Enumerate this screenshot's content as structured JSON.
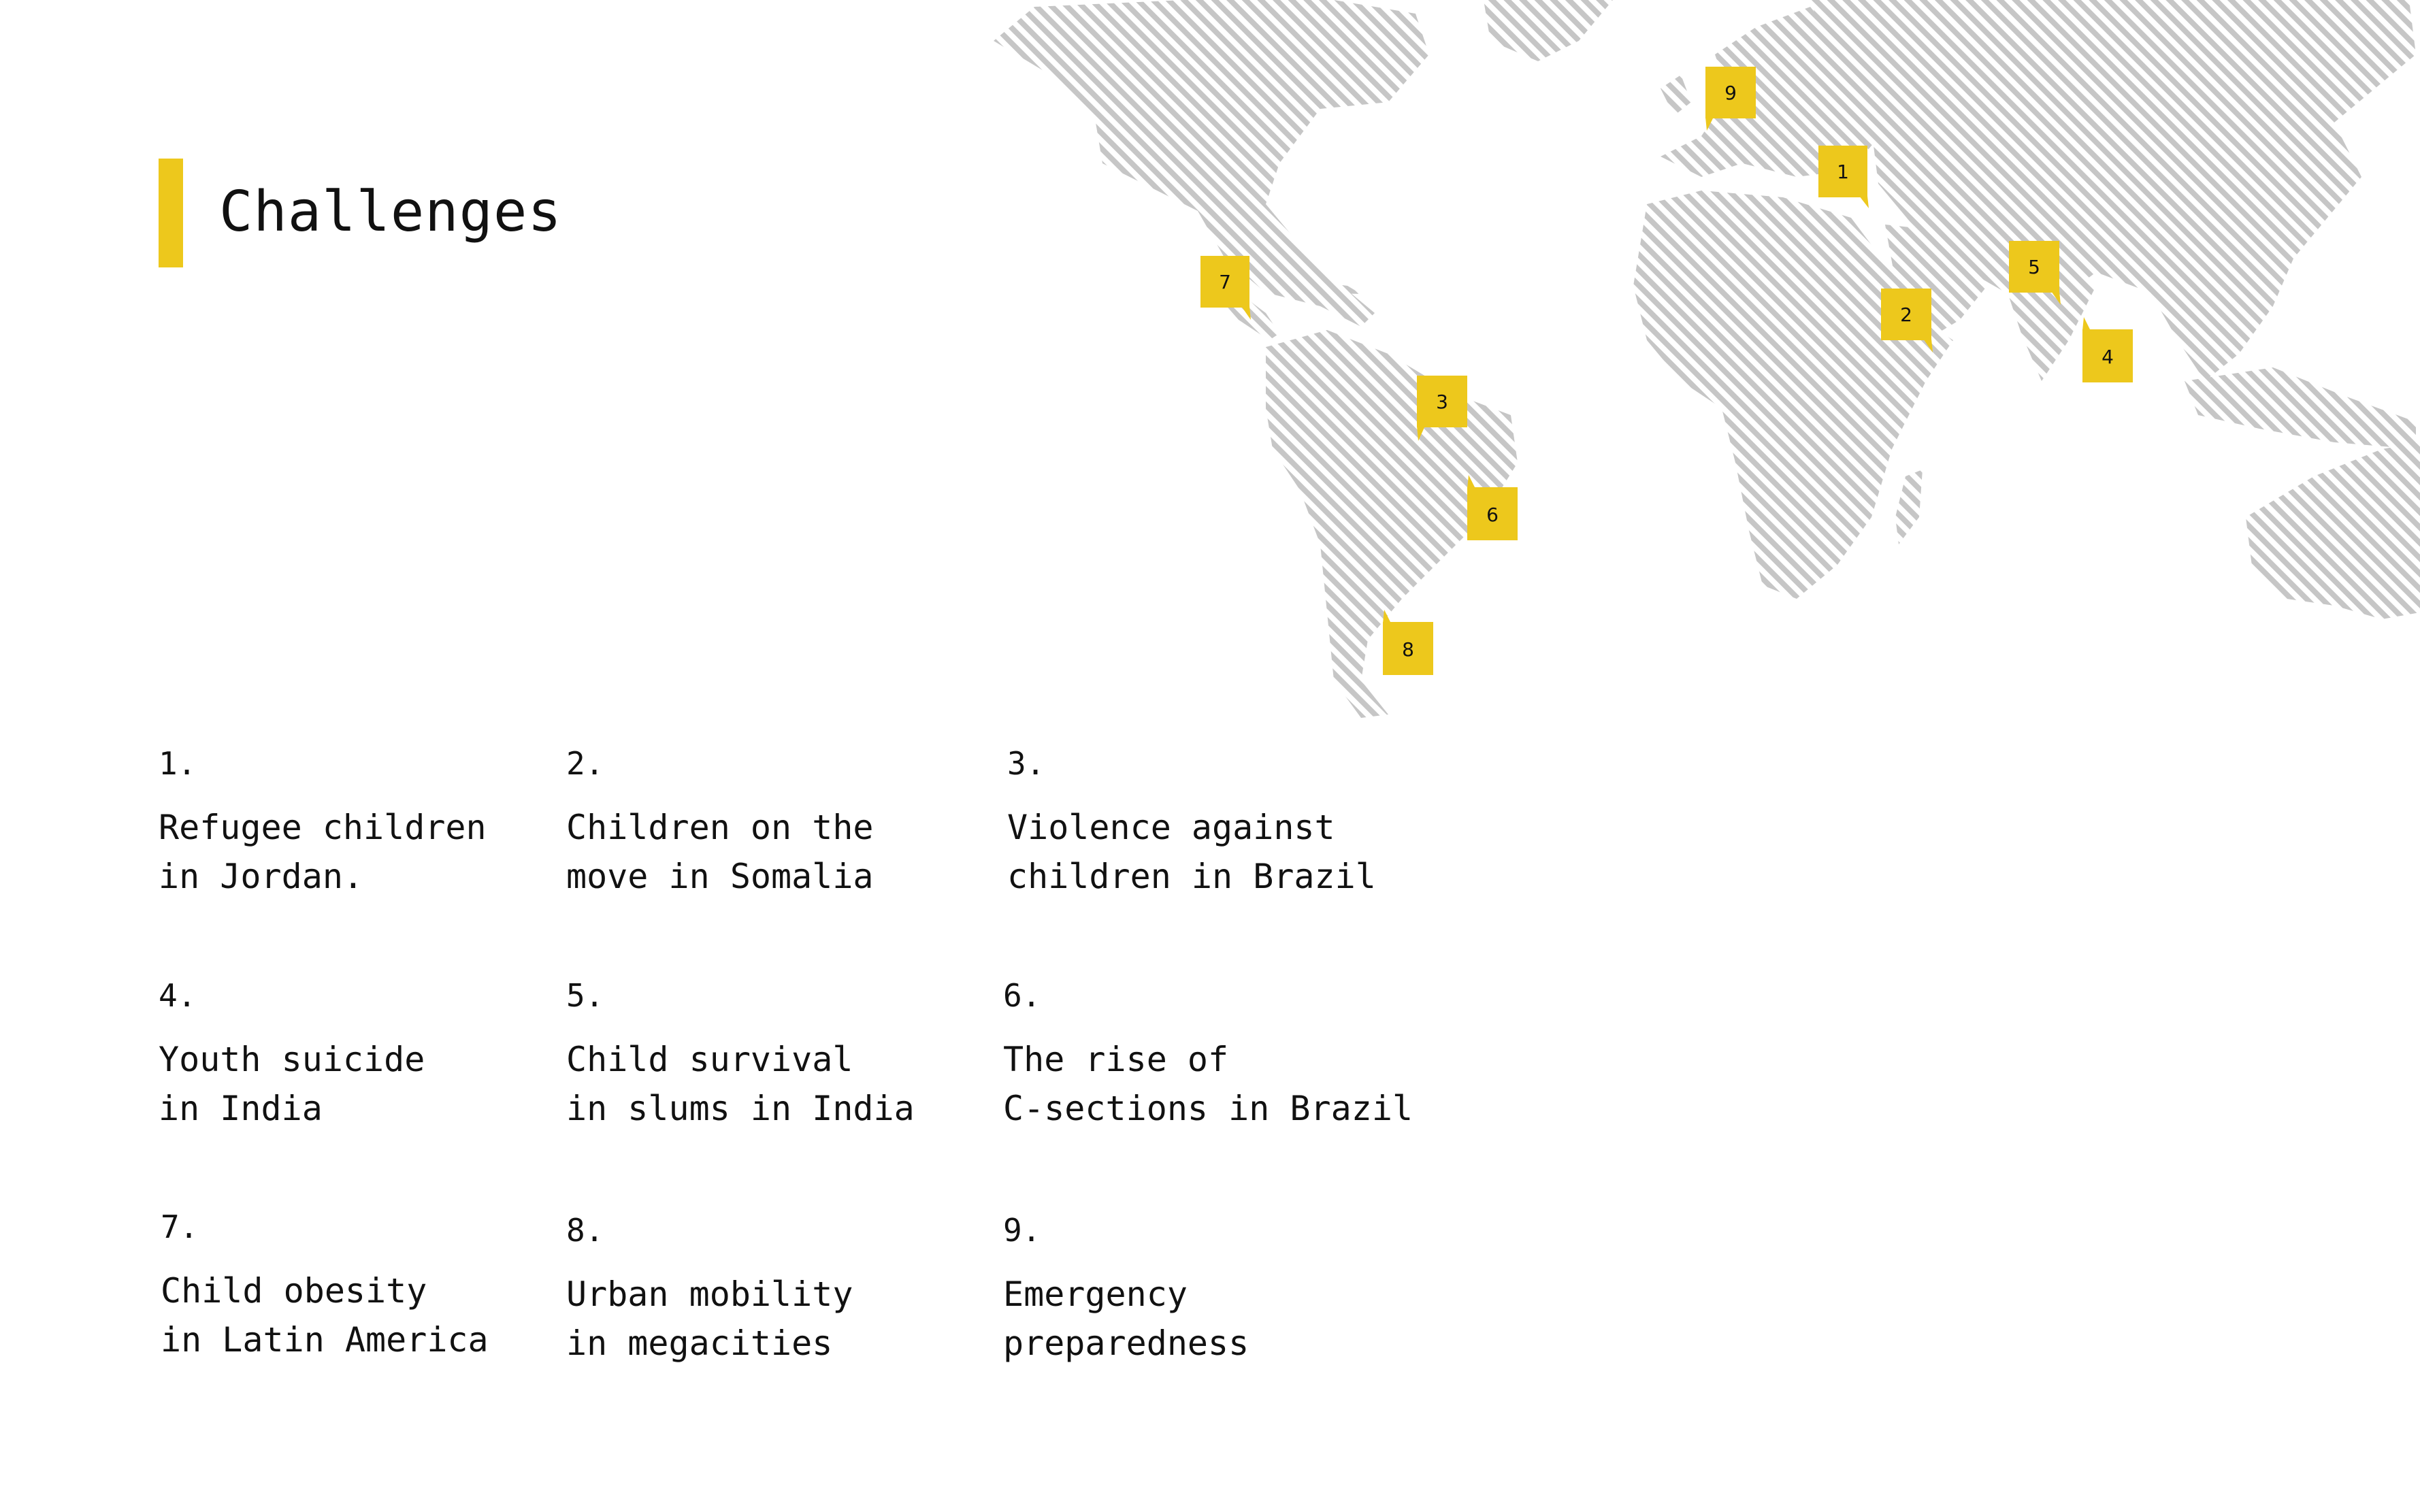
{
  "page": {
    "title": "Challenges",
    "accent_color": "#EDC81C",
    "map_land_color": "#C6C6C6",
    "text_color": "#111111"
  },
  "map": {
    "markers": [
      {
        "id": "1",
        "label": "1",
        "place": "Jordan"
      },
      {
        "id": "2",
        "label": "2",
        "place": "Somalia"
      },
      {
        "id": "3",
        "label": "3",
        "place": "Brazil"
      },
      {
        "id": "4",
        "label": "4",
        "place": "India"
      },
      {
        "id": "5",
        "label": "5",
        "place": "India"
      },
      {
        "id": "6",
        "label": "6",
        "place": "Brazil"
      },
      {
        "id": "7",
        "label": "7",
        "place": "Mexico"
      },
      {
        "id": "8",
        "label": "8",
        "place": "Argentina"
      },
      {
        "id": "9",
        "label": "9",
        "place": "Europe"
      }
    ]
  },
  "challenges": [
    {
      "number": "1.",
      "line1": "Refugee children",
      "line2": "in Jordan."
    },
    {
      "number": "2.",
      "line1": "Children on the",
      "line2": "move in Somalia"
    },
    {
      "number": "3.",
      "line1": "Violence against",
      "line2": "children in Brazil"
    },
    {
      "number": "4.",
      "line1": "Youth suicide",
      "line2": "in India"
    },
    {
      "number": "5.",
      "line1": "Child survival",
      "line2": "in slums in India"
    },
    {
      "number": "6.",
      "line1": "The rise of",
      "line2": "C-sections in Brazil"
    },
    {
      "number": "7.",
      "line1": "Child obesity",
      "line2": "in Latin America"
    },
    {
      "number": "8.",
      "line1": "Urban mobility",
      "line2": "in megacities"
    },
    {
      "number": "9.",
      "line1": "Emergency",
      "line2": "preparedness"
    }
  ]
}
